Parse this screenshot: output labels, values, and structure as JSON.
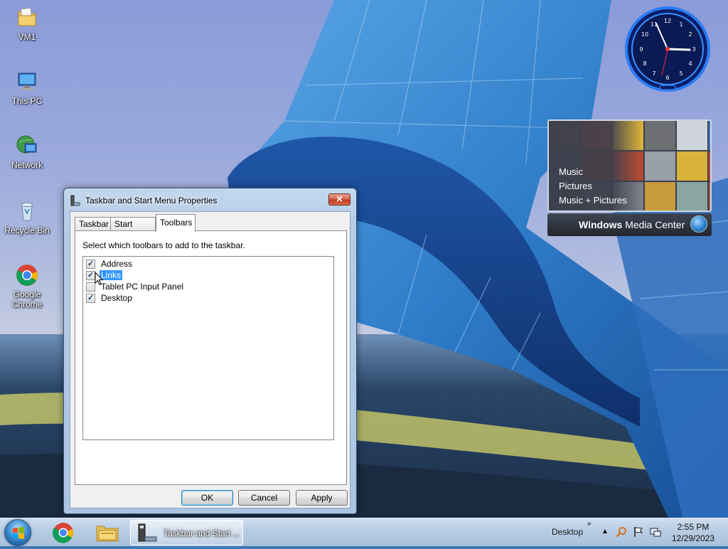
{
  "desktop": {
    "icons": [
      {
        "label": "VM1"
      },
      {
        "label": "This PC"
      },
      {
        "label": "Network"
      },
      {
        "label": "Recycle Bin"
      },
      {
        "label": "Google Chrome"
      }
    ]
  },
  "gadgets": {
    "media_center": {
      "menu": [
        "Music",
        "Pictures",
        "Music + Pictures"
      ],
      "brand_bold": "Windows",
      "brand_rest": " Media Center"
    }
  },
  "dialog": {
    "title": "Taskbar and Start Menu Properties",
    "close_label": "✕",
    "tabs": [
      {
        "label": "Taskbar",
        "active": false
      },
      {
        "label": "Start Menu",
        "active": false
      },
      {
        "label": "Toolbars",
        "active": true
      }
    ],
    "instructions": "Select which toolbars to add to the taskbar.",
    "toolbars": [
      {
        "label": "Address",
        "checked": true,
        "selected": false
      },
      {
        "label": "Links",
        "checked": true,
        "selected": true
      },
      {
        "label": "Tablet PC Input Panel",
        "checked": false,
        "selected": false
      },
      {
        "label": "Desktop",
        "checked": true,
        "selected": false
      }
    ],
    "buttons": {
      "ok": "OK",
      "cancel": "Cancel",
      "apply": "Apply"
    }
  },
  "taskbar": {
    "active_task_label": "Taskbar and Start ...",
    "desktop_toolbar_label": "Desktop",
    "chevron": "»",
    "tray_up": "▲",
    "time": "2:55 PM",
    "date": "12/29/2023"
  }
}
